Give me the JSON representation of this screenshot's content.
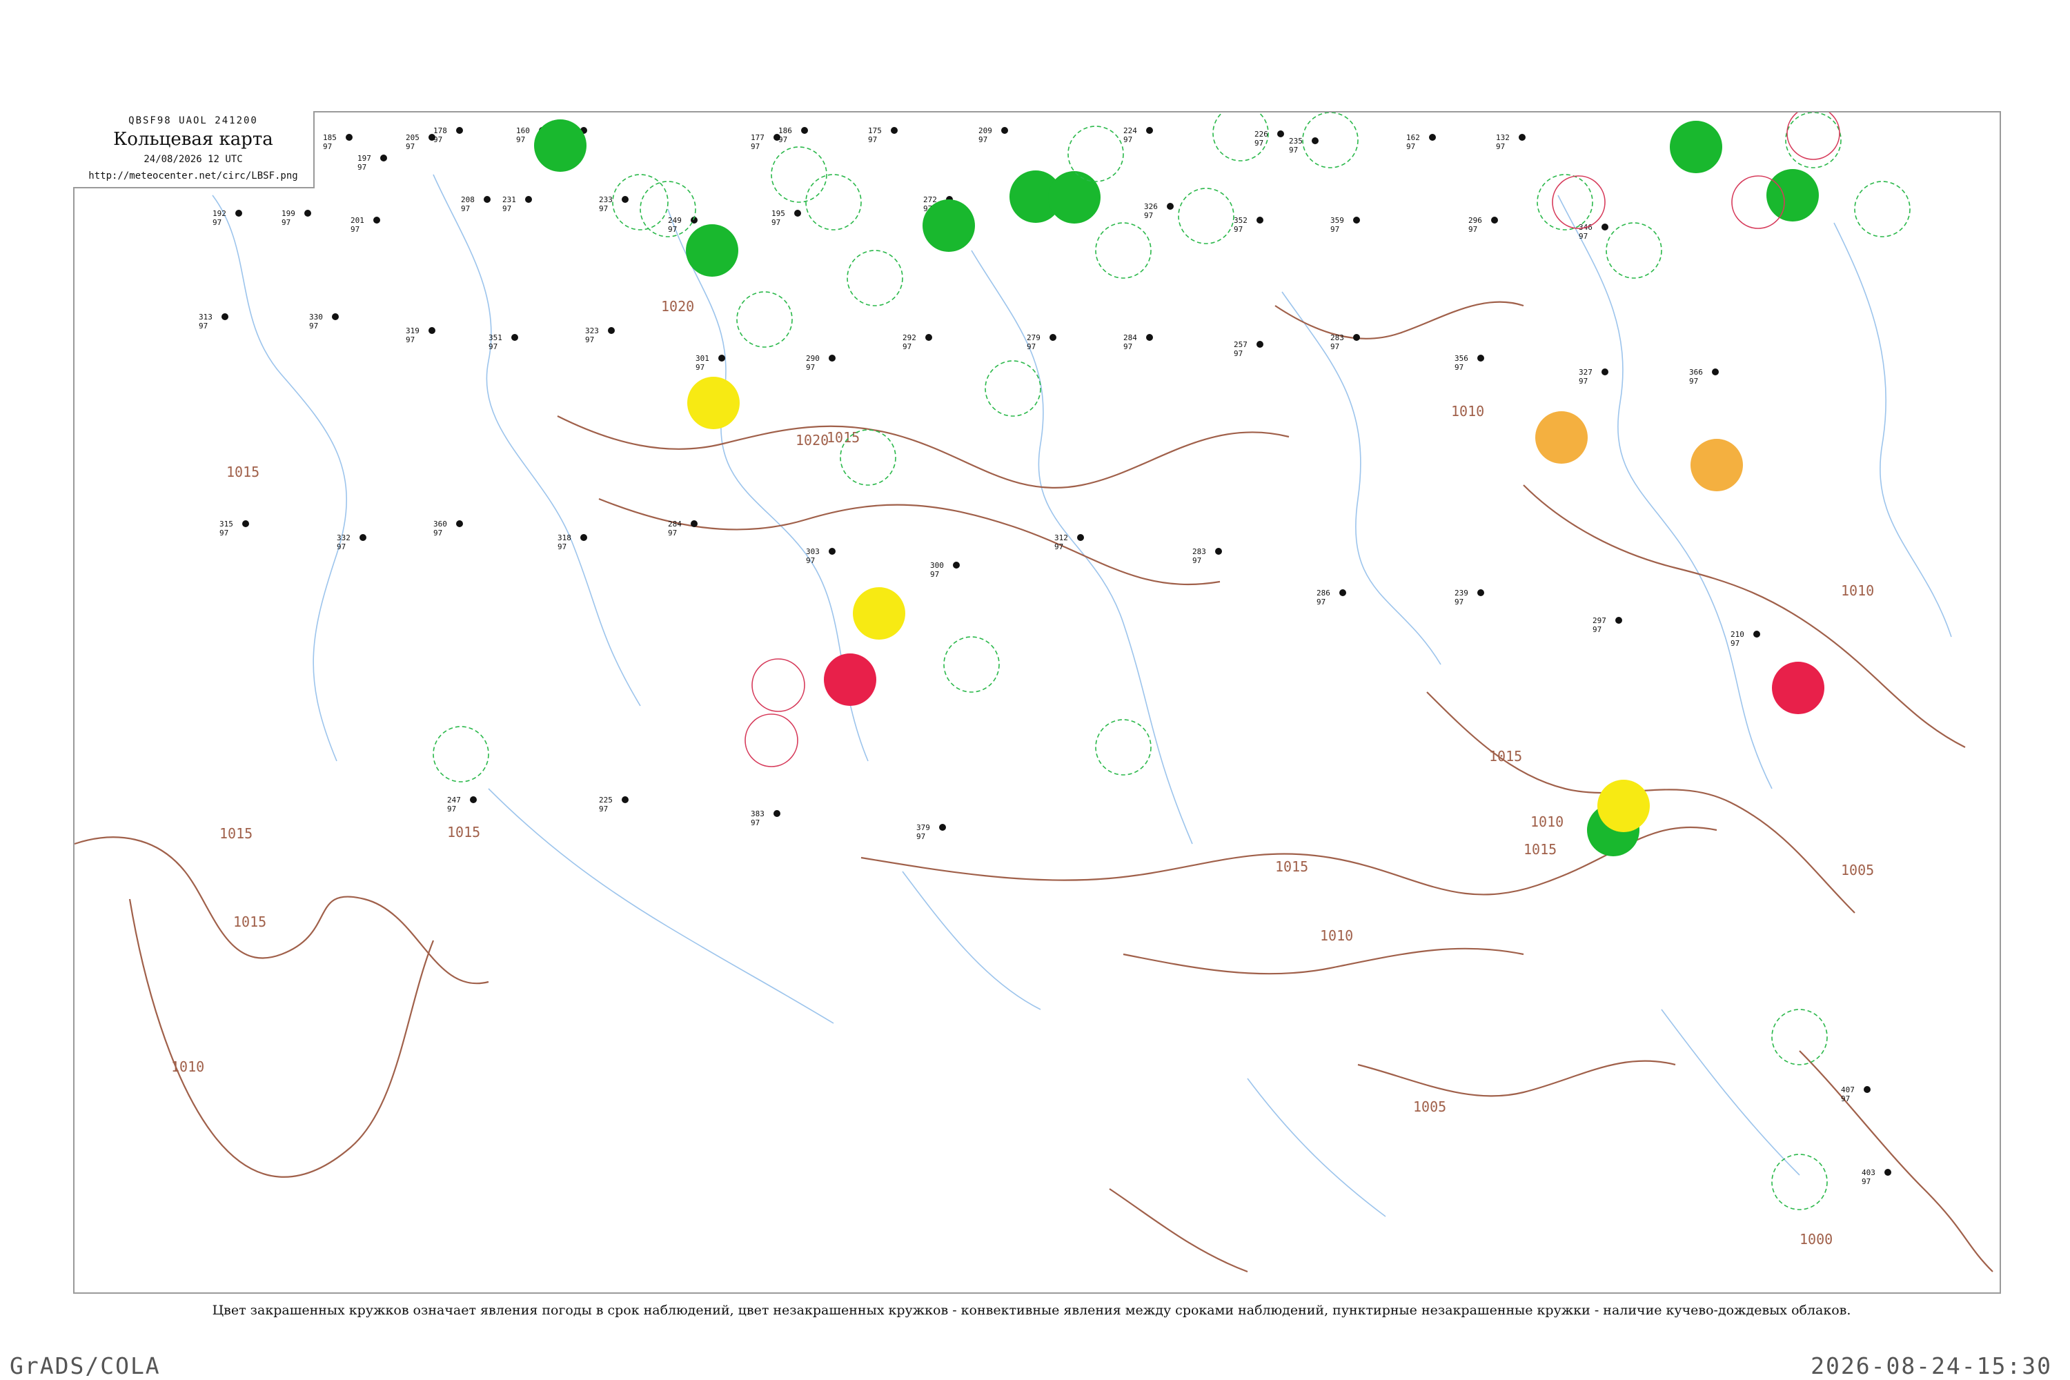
{
  "header": {
    "code_line": "QBSF98  UAOL  241200",
    "title": "Кольцевая карта",
    "date_line": "24/08/2026 12 UTC",
    "url": "http://meteocenter.net/circ/LBSF.png"
  },
  "legend_note": "Цвет закрашенных кружков означает явления погоды в срок наблюдений, цвет незакрашенных кружков - конвективные явления между сроками наблюдений, пунктирные незакрашенные кружки - наличие кучево-дождевых облаков.",
  "footer": {
    "left": "GrADS/COLA",
    "right": "2026-08-24-15:30"
  },
  "colors": {
    "isobar": "#a0604a",
    "river": "#9cc4ec",
    "frame": "#9a9a9a",
    "phenomena_green": "#19b82e",
    "phenomena_yellow": "#f7ea13",
    "phenomena_orange": "#f4b040",
    "phenomena_red": "#e8204a",
    "cb_dashed": "#2ab84a",
    "convective_red": "#d63a5a"
  },
  "isobar_labels": [
    {
      "text": "1020",
      "id": "a"
    },
    {
      "text": "1020",
      "id": "b"
    },
    {
      "text": "1015",
      "id": "c"
    },
    {
      "text": "1015",
      "id": "d"
    },
    {
      "text": "1015",
      "id": "e"
    },
    {
      "text": "1015",
      "id": "f"
    },
    {
      "text": "1015",
      "id": "g"
    },
    {
      "text": "1015",
      "id": "h"
    },
    {
      "text": "1015",
      "id": "i"
    },
    {
      "text": "1015",
      "id": "j"
    },
    {
      "text": "1010",
      "id": "k"
    },
    {
      "text": "1010",
      "id": "l"
    },
    {
      "text": "1010",
      "id": "m"
    },
    {
      "text": "1010",
      "id": "n"
    },
    {
      "text": "1010",
      "id": "o"
    },
    {
      "text": "1005",
      "id": "p"
    },
    {
      "text": "1005",
      "id": "q"
    },
    {
      "text": "1000",
      "id": "r"
    }
  ],
  "station_numbers": [
    "185",
    "197",
    "205",
    "178",
    "160",
    "175",
    "177",
    "186",
    "175",
    "209",
    "224",
    "226",
    "235",
    "162",
    "132",
    "192",
    "199",
    "201",
    "208",
    "231",
    "233",
    "249",
    "195",
    "272",
    "303",
    "326",
    "352",
    "359",
    "296",
    "346",
    "313",
    "330",
    "319",
    "351",
    "323",
    "301",
    "290",
    "292",
    "279",
    "284",
    "257",
    "283",
    "356",
    "327",
    "366",
    "315",
    "332",
    "360",
    "318",
    "284",
    "303",
    "300",
    "312",
    "283",
    "286",
    "239",
    "297",
    "210",
    "247",
    "225",
    "383",
    "379",
    "407",
    "403"
  ],
  "filled_circles": [
    {
      "kind": "green"
    },
    {
      "kind": "green"
    },
    {
      "kind": "green"
    },
    {
      "kind": "green"
    },
    {
      "kind": "green"
    },
    {
      "kind": "green"
    },
    {
      "kind": "green"
    },
    {
      "kind": "green"
    },
    {
      "kind": "yellow"
    },
    {
      "kind": "yellow"
    },
    {
      "kind": "yellow"
    },
    {
      "kind": "orange"
    },
    {
      "kind": "orange"
    },
    {
      "kind": "red"
    },
    {
      "kind": "red"
    }
  ]
}
